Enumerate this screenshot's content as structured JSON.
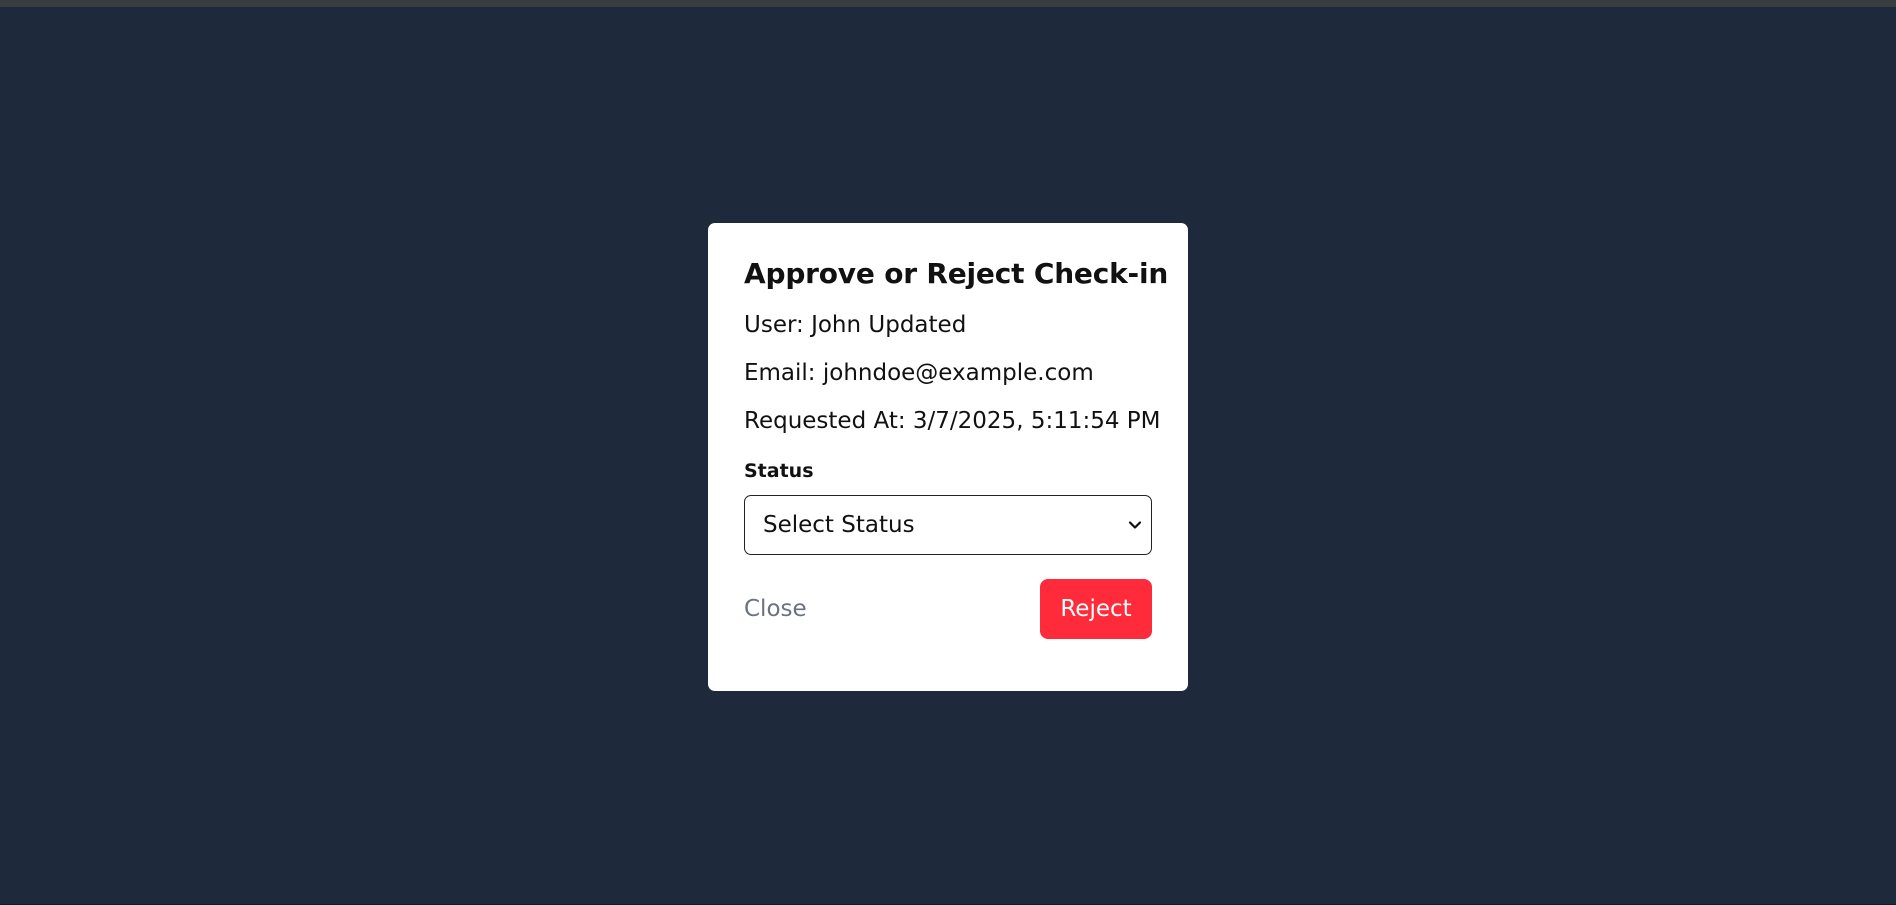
{
  "modal": {
    "title": "Approve or Reject Check-in",
    "user_line": "User: John Updated",
    "email_line": "Email: johndoe@example.com",
    "requested_line": "Requested At: 3/7/2025, 5:11:54 PM",
    "status_label": "Status",
    "status_select": {
      "selected": "Select Status",
      "icon": "chevron-down-icon"
    },
    "close_label": "Close",
    "reject_label": "Reject"
  },
  "colors": {
    "backdrop": "#1e293b",
    "reject": "#ff2a3a",
    "close_text": "#6b7280"
  }
}
